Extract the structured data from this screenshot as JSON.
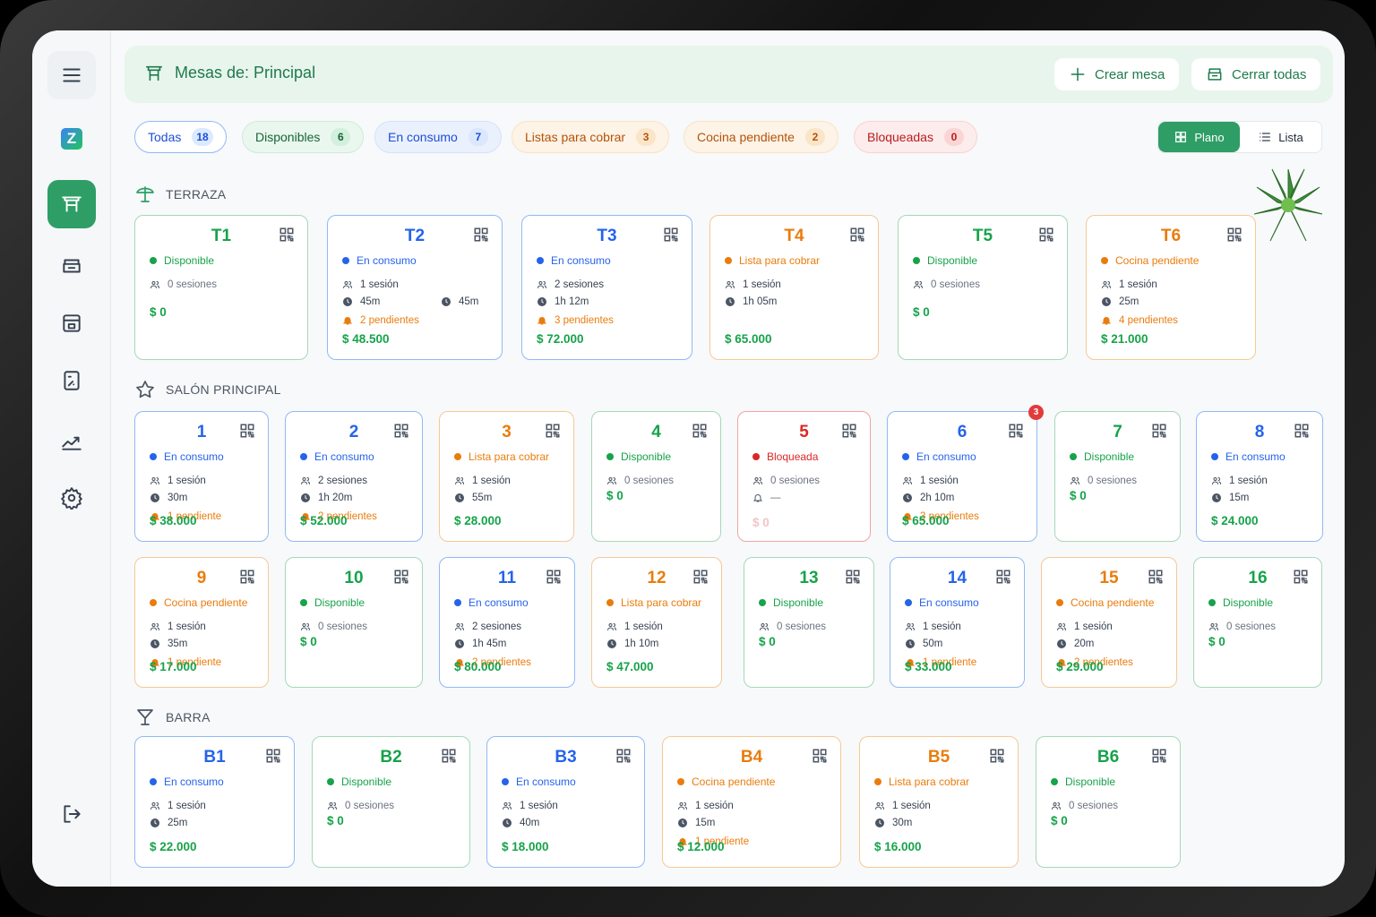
{
  "header": {
    "title": "Mesas de: Principal",
    "create_label": "Crear mesa",
    "close_label": "Cerrar todas"
  },
  "filters": [
    {
      "label": "Todas",
      "count": "18"
    },
    {
      "label": "Disponibles",
      "count": "6"
    },
    {
      "label": "En consumo",
      "count": "7"
    },
    {
      "label": "Listas para cobrar",
      "count": "3"
    },
    {
      "label": "Cocina pendiente",
      "count": "2"
    },
    {
      "label": "Bloqueadas",
      "count": "0"
    }
  ],
  "view": {
    "plano": "Plano",
    "lista": "Lista"
  },
  "sections": {
    "terraza": "TERRAZA",
    "salon": "SALÓN PRINCIPAL",
    "barra": "BARRA"
  },
  "colors": {
    "green": "#16a34a",
    "blue": "#2563eb",
    "orange": "#ea7c0c",
    "red": "#dc2626",
    "brand": "#2e9e66"
  },
  "terraza": [
    {
      "name": "T1",
      "status": "Disponible",
      "sessions": "0 sesiones",
      "price": "$ 0"
    },
    {
      "name": "T2",
      "status": "En consumo",
      "sessions": "1 sesión",
      "time": "45m",
      "time2": "45m",
      "pending": "2 pendientes",
      "price": "$ 48.500"
    },
    {
      "name": "T3",
      "status": "En consumo",
      "sessions": "2 sesiones",
      "time": "1h 12m",
      "pending": "3 pendientes",
      "price": "$ 72.000"
    },
    {
      "name": "T4",
      "status": "Lista para cobrar",
      "sessions": "1 sesión",
      "time": "1h 05m",
      "price": "$ 65.000"
    },
    {
      "name": "T5",
      "status": "Disponible",
      "sessions": "0 sesiones",
      "price": "$ 0"
    },
    {
      "name": "T6",
      "status": "Cocina pendiente",
      "sessions": "1 sesión",
      "time": "25m",
      "pending": "4 pendientes",
      "price": "$ 21.000"
    }
  ],
  "salon": [
    {
      "name": "1",
      "status": "En consumo",
      "sessions": "1 sesión",
      "time": "30m",
      "pending": "1 pendiente",
      "price": "$ 38.000"
    },
    {
      "name": "2",
      "status": "En consumo",
      "sessions": "2 sesiones",
      "time": "1h 20m",
      "pending": "2 pendientes",
      "price": "$ 52.000"
    },
    {
      "name": "3",
      "status": "Lista para cobrar",
      "sessions": "1 sesión",
      "time": "55m",
      "price": "$ 28.000"
    },
    {
      "name": "4",
      "status": "Disponible",
      "sessions": "0 sesiones",
      "price": "$ 0"
    },
    {
      "name": "5",
      "status": "Bloqueada",
      "sessions": "0 sesiones",
      "blocked": "—",
      "price": "$ 0"
    },
    {
      "name": "6",
      "status": "En consumo",
      "sessions": "1 sesión",
      "time": "2h 10m",
      "pending": "3 pendientes",
      "price": "$ 65.000",
      "badge": "3"
    },
    {
      "name": "7",
      "status": "Disponible",
      "sessions": "0 sesiones",
      "price": "$ 0"
    },
    {
      "name": "8",
      "status": "En consumo",
      "sessions": "1 sesión",
      "time": "15m",
      "price": "$ 24.000"
    },
    {
      "name": "9",
      "status": "Cocina pendiente",
      "sessions": "1 sesión",
      "time": "35m",
      "pending": "1 pendiente",
      "price": "$ 17.000"
    },
    {
      "name": "10",
      "status": "Disponible",
      "sessions": "0 sesiones",
      "price": "$ 0"
    },
    {
      "name": "11",
      "status": "En consumo",
      "sessions": "2 sesiones",
      "time": "1h 45m",
      "pending": "2 pendientes",
      "price": "$ 80.000"
    },
    {
      "name": "12",
      "status": "Lista para cobrar",
      "sessions": "1 sesión",
      "time": "1h 10m",
      "price": "$ 47.000"
    },
    {
      "name": "13",
      "status": "Disponible",
      "sessions": "0 sesiones",
      "price": "$ 0"
    },
    {
      "name": "14",
      "status": "En consumo",
      "sessions": "1 sesión",
      "time": "50m",
      "pending": "1 pendiente",
      "price": "$ 33.000"
    },
    {
      "name": "15",
      "status": "Cocina pendiente",
      "sessions": "1 sesión",
      "time": "20m",
      "pending": "2 pendientes",
      "price": "$ 29.000"
    },
    {
      "name": "16",
      "status": "Disponible",
      "sessions": "0 sesiones",
      "price": "$ 0"
    }
  ],
  "barra": [
    {
      "name": "B1",
      "status": "En consumo",
      "sessions": "1 sesión",
      "time": "25m",
      "price": "$ 22.000"
    },
    {
      "name": "B2",
      "status": "Disponible",
      "sessions": "0 sesiones",
      "price": "$ 0"
    },
    {
      "name": "B3",
      "status": "En consumo",
      "sessions": "1 sesión",
      "time": "40m",
      "price": "$ 18.000"
    },
    {
      "name": "B4",
      "status": "Cocina pendiente",
      "sessions": "1 sesión",
      "time": "15m",
      "pending": "1 pendiente",
      "price": "$ 12.000"
    },
    {
      "name": "B5",
      "status": "Lista para cobrar",
      "sessions": "1 sesión",
      "time": "30m",
      "price": "$ 16.000"
    },
    {
      "name": "B6",
      "status": "Disponible",
      "sessions": "0 sesiones",
      "price": "$ 0"
    }
  ]
}
